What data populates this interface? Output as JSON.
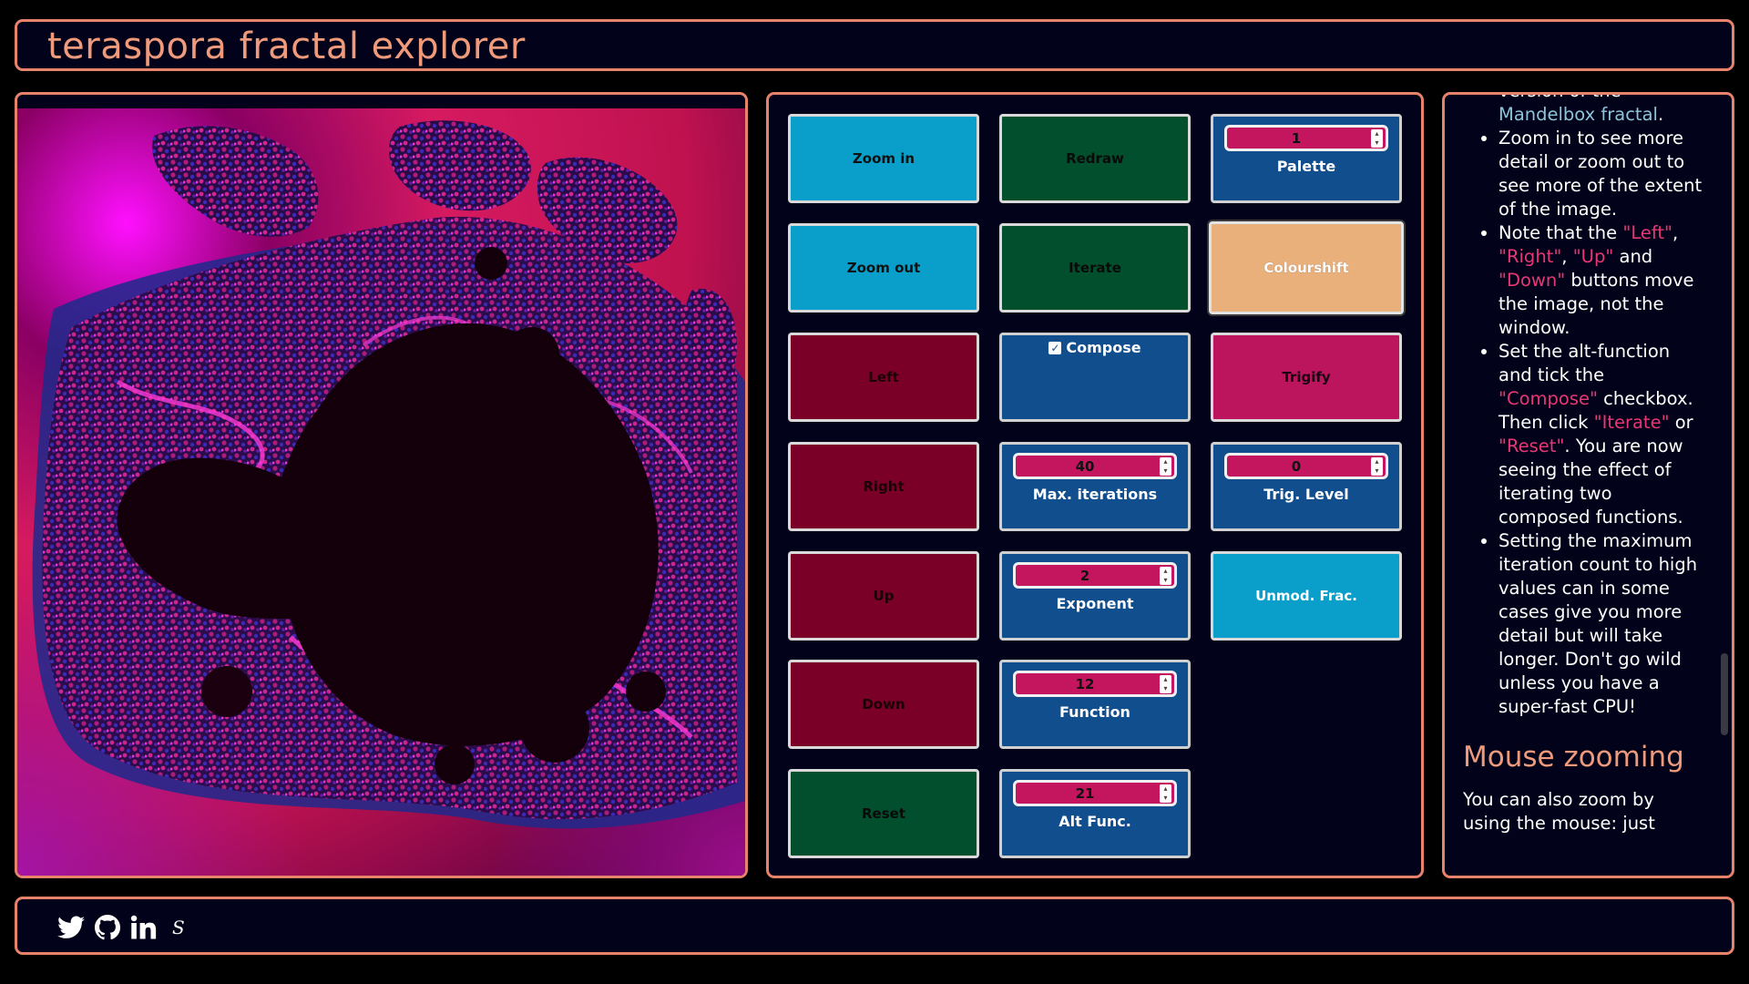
{
  "header": {
    "title": "teraspora fractal explorer"
  },
  "controls": {
    "zoom_in": "Zoom in",
    "zoom_out": "Zoom out",
    "left": "Left",
    "right": "Right",
    "up": "Up",
    "down": "Down",
    "reset": "Reset",
    "redraw": "Redraw",
    "iterate": "Iterate",
    "compose": {
      "label": "Compose",
      "checked": true
    },
    "max_iterations": {
      "label": "Max. iterations",
      "value": "40"
    },
    "exponent": {
      "label": "Exponent",
      "value": "2"
    },
    "function": {
      "label": "Function",
      "value": "12"
    },
    "alt_func": {
      "label": "Alt Func.",
      "value": "21"
    },
    "palette": {
      "label": "Palette",
      "value": "1"
    },
    "colourshift": "Colourshift",
    "trigify": "Trigify",
    "trig_level": {
      "label": "Trig. Level",
      "value": "0"
    },
    "unmod_frac": "Unmod. Frac."
  },
  "help": {
    "top_partial": "version of the",
    "mandelbox_link": "Mandelbox fractal",
    "li1": "Zoom in to see more detail or zoom out to see more of the extent of the image.",
    "li2_a": "Note that the ",
    "left": "\"Left\"",
    "comma1": ", ",
    "right": "\"Right\"",
    "comma2": ", ",
    "up": "\"Up\"",
    "and": " and ",
    "down": "\"Down\"",
    "li2_b": " buttons move the image, not the window.",
    "li3_a": "Set the alt-function and tick the ",
    "compose": "\"Compose\"",
    "li3_b": " checkbox. Then click ",
    "iterate": "\"Iterate\"",
    "or": " or ",
    "reset": "\"Reset\"",
    "li3_c": ". You are now seeing the effect of iterating two composed functions.",
    "li4": "Setting the maximum iteration count to high values can in some cases give you more detail but will take longer. Don't go wild unless you have a super-fast CPU!",
    "heading": "Mouse zooming",
    "para": "You can also zoom by using the mouse: just"
  },
  "footer": {
    "icons": [
      "twitter-icon",
      "github-icon",
      "linkedin-icon",
      "s-icon"
    ],
    "s_glyph": "S"
  },
  "colors": {
    "border": "#e8836b",
    "title": "#ef9a7a",
    "cyan": "#0a9fcb",
    "green": "#014f2d",
    "maroon": "#7b0027",
    "pink": "#bd145e",
    "peach": "#e9b07c",
    "blue": "#114e8e",
    "highlight": "#e73774"
  }
}
